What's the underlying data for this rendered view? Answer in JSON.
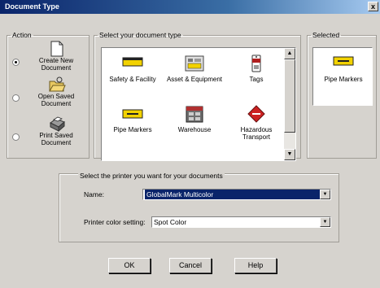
{
  "window": {
    "title": "Document Type",
    "close_glyph": "x"
  },
  "action": {
    "legend": "Action",
    "options": [
      {
        "label": "Create New Document",
        "icon": "new-document-icon",
        "checked": true
      },
      {
        "label": "Open Saved Document",
        "icon": "open-folder-icon",
        "checked": false
      },
      {
        "label": "Print Saved Document",
        "icon": "printer-icon",
        "checked": false
      }
    ]
  },
  "doctype": {
    "legend": "Select your document type",
    "items": [
      {
        "label": "Safety & Facility",
        "icon": "safety-sign-icon"
      },
      {
        "label": "Asset & Equipment",
        "icon": "asset-tag-icon"
      },
      {
        "label": "Tags",
        "icon": "tag-icon"
      },
      {
        "label": "Pipe Markers",
        "icon": "pipe-marker-icon"
      },
      {
        "label": "Warehouse",
        "icon": "warehouse-icon"
      },
      {
        "label": "Hazardous Transport",
        "icon": "hazard-diamond-icon"
      }
    ],
    "scroll_up": "▲",
    "scroll_down": "▼"
  },
  "selected": {
    "legend": "Selected",
    "label": "Pipe Markers",
    "icon": "pipe-marker-icon"
  },
  "printer": {
    "caption": "Select the printer you want for your documents",
    "name_label": "Name:",
    "name_value": "GlobalMark Multicolor",
    "color_label": "Printer color setting:",
    "color_value": "Spot Color",
    "dropdown_glyph": "▼"
  },
  "buttons": {
    "ok": "OK",
    "cancel": "Cancel",
    "help": "Help"
  },
  "colors": {
    "titlebar": "#0a246a",
    "face": "#d6d3ce",
    "pipe_marker_yellow": "#f2d200",
    "hazard_red": "#cc2222",
    "selection": "#0a246a"
  }
}
